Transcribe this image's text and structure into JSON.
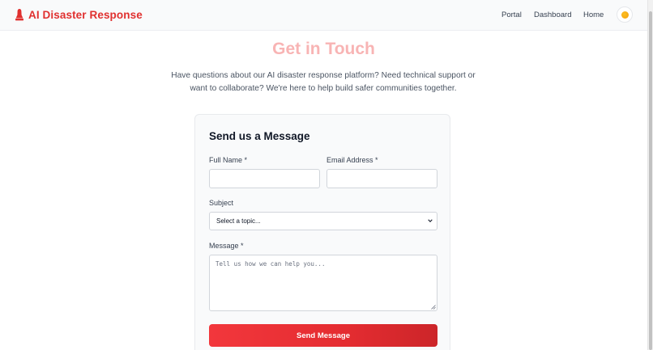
{
  "nav": {
    "brand": "AI Disaster Response",
    "links": [
      "Portal",
      "Dashboard",
      "Home"
    ],
    "theme_icon": "sun-icon"
  },
  "header": {
    "title": "Get in Touch",
    "subtitle": "Have questions about our AI disaster response platform? Need technical support or want to collaborate? We're here to help build safer communities together."
  },
  "form": {
    "heading": "Send us a Message",
    "full_name_label": "Full Name *",
    "full_name_value": "",
    "email_label": "Email Address *",
    "email_value": "",
    "subject_label": "Subject",
    "subject_selected": "Select a topic...",
    "message_label": "Message *",
    "message_placeholder": "Tell us how we can help you...",
    "submit_label": "Send Message"
  },
  "colors": {
    "brand": "#e0302f",
    "title": "#f8b4b4",
    "button": "#e42c31"
  }
}
